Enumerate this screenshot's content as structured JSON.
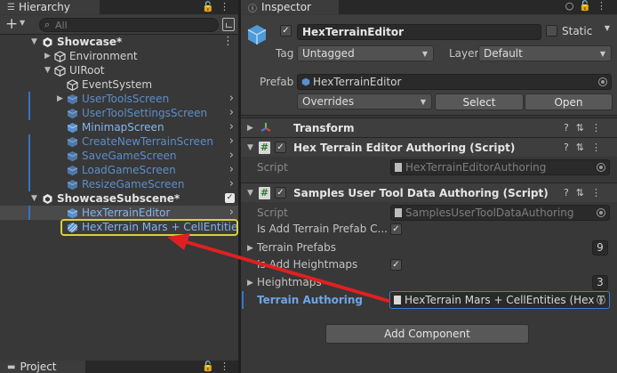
{
  "hierarchy": {
    "tab_title": "Hierarchy",
    "search_placeholder": "All",
    "add_label": "+",
    "items": [
      {
        "label": "Showcase*",
        "style": "scene"
      },
      {
        "label": "Environment",
        "style": "normal"
      },
      {
        "label": "UIRoot",
        "style": "normal"
      },
      {
        "label": "EventSystem",
        "style": "normal"
      },
      {
        "label": "UserToolsScreen",
        "style": "disabled"
      },
      {
        "label": "UserToolSettingsScreen",
        "style": "disabled"
      },
      {
        "label": "MinimapScreen",
        "style": "enabled"
      },
      {
        "label": "CreateNewTerrainScreen",
        "style": "disabled"
      },
      {
        "label": "SaveGameScreen",
        "style": "disabled"
      },
      {
        "label": "LoadGameScreen",
        "style": "disabled"
      },
      {
        "label": "ResizeGameScreen",
        "style": "disabled"
      },
      {
        "label": "ShowcaseSubscene*",
        "style": "subscene"
      },
      {
        "label": "HexTerrainEditor",
        "style": "selected"
      },
      {
        "label": "HexTerrain Mars + CellEntities",
        "style": "highlighted"
      }
    ]
  },
  "project": {
    "tab_title": "Project"
  },
  "inspector": {
    "tab_title": "Inspector",
    "object_name": "HexTerrainEditor",
    "static_label": "Static",
    "tag_label": "Tag",
    "tag_value": "Untagged",
    "layer_label": "Layer",
    "layer_value": "Default",
    "prefab_label": "Prefab",
    "prefab_value": "HexTerrainEditor",
    "overrides_label": "Overrides",
    "select_label": "Select",
    "open_label": "Open",
    "components": {
      "transform": {
        "title": "Transform"
      },
      "hex_authoring": {
        "title": "Hex Terrain Editor Authoring (Script)",
        "script_label": "Script",
        "script_value": "HexTerrainEditorAuthoring"
      },
      "samples_authoring": {
        "title": "Samples User Tool Data Authoring (Script)",
        "script_label": "Script",
        "script_value": "SamplesUserToolDataAuthoring",
        "is_add_terrain_label": "Is Add Terrain Prefab C...",
        "is_add_terrain_checked": true,
        "terrain_prefabs_label": "Terrain Prefabs",
        "terrain_prefabs_count": "9",
        "is_add_heightmaps_label": "Is Add Heightmaps",
        "is_add_heightmaps_checked": true,
        "heightmaps_label": "Heightmaps",
        "heightmaps_count": "3",
        "terrain_authoring_label": "Terrain Authoring",
        "terrain_authoring_value": "HexTerrain Mars + CellEntities (Hex T"
      }
    },
    "add_component_label": "Add Component"
  },
  "colors": {
    "panel_bg": "#383838",
    "highlight_outline": "#d8d03c",
    "arrow": "#e02020",
    "selection_blue": "#3b7ed4"
  }
}
